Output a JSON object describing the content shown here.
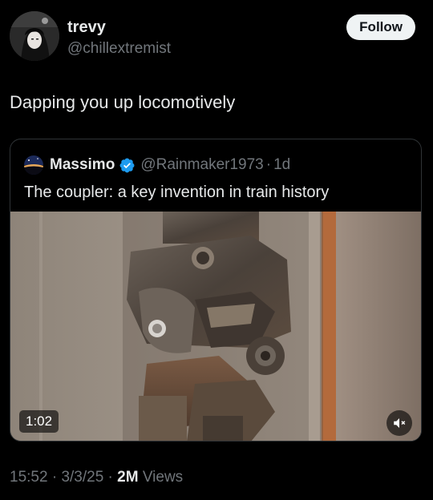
{
  "author": {
    "name": "trevy",
    "handle": "@chillextremist",
    "follow_label": "Follow"
  },
  "tweet": {
    "text": "Dapping you up locomotively"
  },
  "quote": {
    "name": "Massimo",
    "verified_icon": "verified-badge-icon",
    "handle": "@Rainmaker1973",
    "separator": "·",
    "time": "1d",
    "text": "The coupler: a key invention in train history",
    "video": {
      "duration": "1:02",
      "mute_icon": "speaker-muted-icon"
    }
  },
  "meta": {
    "time": "15:52",
    "sep1": "·",
    "date": "3/3/25",
    "sep2": "·",
    "views_count": "2M",
    "views_label": "Views"
  },
  "colors": {
    "background": "#000000",
    "text_primary": "#e7e9ea",
    "text_secondary": "#71767b",
    "border": "#2f3336",
    "verified_blue": "#1d9bf0",
    "follow_bg": "#eff3f4"
  }
}
